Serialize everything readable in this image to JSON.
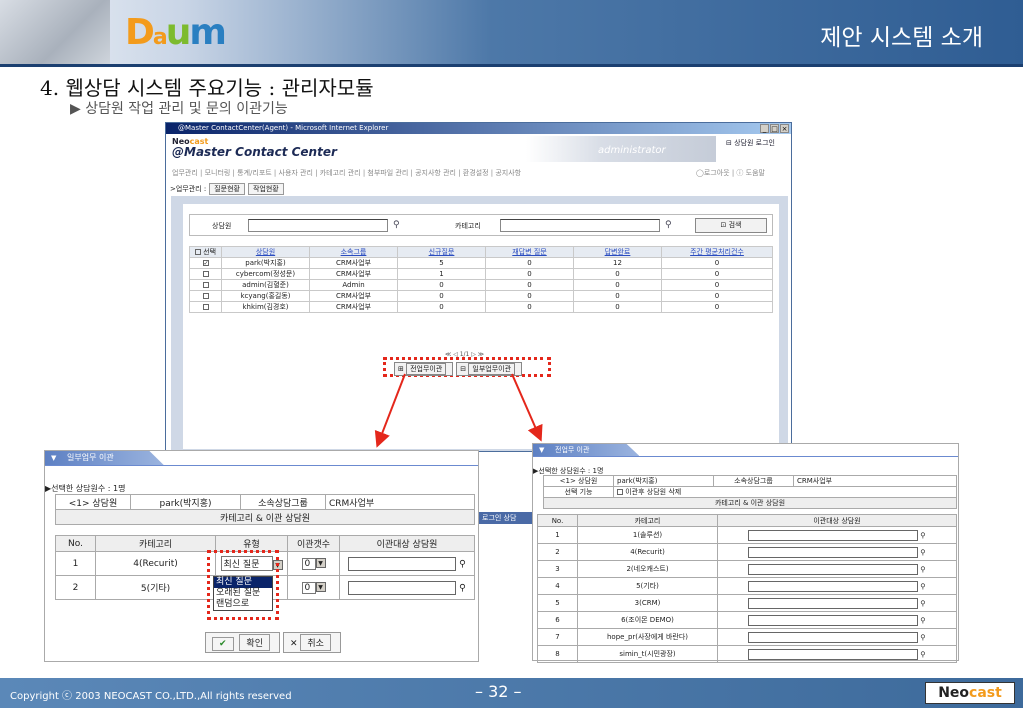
{
  "header": {
    "logo_d": "D",
    "logo_a": "a",
    "logo_u": "u",
    "logo_m": "m",
    "title": "제안 시스템 소개"
  },
  "slide": {
    "heading": "4. 웹상담 시스템 주요기능 : 관리자모듈",
    "subheading": "▶ 상담원 작업 관리 및 문의 이관기능"
  },
  "footer": {
    "copyright": "Copyright ⓒ 2003 NEOCAST CO.,LTD.,All rights reserved",
    "page": "– 32 –",
    "brand_a": "Neo",
    "brand_b": "cast"
  },
  "window": {
    "title": "@Master ContactCenter(Agent) - Microsoft Internet Explorer",
    "brand_top_a": "Neo",
    "brand_top_b": "cast",
    "brand_main": "@Master  Contact  Center",
    "user_label": "administrator",
    "logout_link": "상담원 로그인",
    "menu": "업무관리 | 모니터링 | 통계/리포트 | 사용자 관리 | 카테고리 관리 | 첨부파일 관리 | 공지사항 관리 | 환경설정 | 공지사항",
    "menu_right": "◯로그아웃 | ⓘ 도움말",
    "sub_prefix": ">업무관리 :",
    "sub_tabs": [
      "질문현황",
      "작업현황"
    ],
    "search": {
      "agent_label": "상담원",
      "category_label": "카테고리",
      "button": "검색"
    },
    "table": {
      "headers": [
        "선택",
        "상담원",
        "소속그룹",
        "신규질문",
        "재답변 질문",
        "답변완료",
        "주간 평균처리건수"
      ],
      "rows": [
        {
          "checked": true,
          "name": "park(박지홍)",
          "group": "CRM사업부",
          "new": "5",
          "re": "0",
          "done": "12",
          "avg": "0"
        },
        {
          "checked": false,
          "name": "cybercom(정성문)",
          "group": "CRM사업부",
          "new": "1",
          "re": "0",
          "done": "0",
          "avg": "0"
        },
        {
          "checked": false,
          "name": "admin(김혈준)",
          "group": "Admin",
          "new": "0",
          "re": "0",
          "done": "0",
          "avg": "0"
        },
        {
          "checked": false,
          "name": "kcyang(홍길동)",
          "group": "CRM사업부",
          "new": "0",
          "re": "0",
          "done": "0",
          "avg": "0"
        },
        {
          "checked": false,
          "name": "khkim(김경호)",
          "group": "CRM사업부",
          "new": "0",
          "re": "0",
          "done": "0",
          "avg": "0"
        }
      ]
    },
    "pager": "≪ ◁ 1/1 ▷ ≫",
    "btn_all": "전업무이관",
    "btn_part": "일부업무이관"
  },
  "popup_part": {
    "tab": "일부업무 이관",
    "selected_count": "▶선택한 상담원수 : 1명",
    "agent_label": "<1> 상담원",
    "agent_value": "park(박지홍)",
    "group_label": "소속상담그룹",
    "group_value": "CRM사업부",
    "section": "카테고리 & 이관 상담원",
    "headers": [
      "No.",
      "카테고리",
      "유형",
      "이관갯수",
      "이관대상 상담원"
    ],
    "rows": [
      {
        "no": "1",
        "cat": "4(Recurit)",
        "type": "최신 질문",
        "count": "0"
      },
      {
        "no": "2",
        "cat": "5(기타)",
        "type": "",
        "count": "0"
      }
    ],
    "options": [
      "최신 질문",
      "오래된 질문",
      "랜덤으로"
    ],
    "ok": "확인",
    "cancel": "취소"
  },
  "behind_label": "로그인 상담",
  "popup_all": {
    "tab": "전업무 이관",
    "selected_count": "▶선택한 상담원수 : 1명",
    "agent_label": "<1> 상담원",
    "agent_value": "park(박지홍)",
    "group_label": "소속상담그룹",
    "group_value": "CRM사업부",
    "func_label": "선택 기능",
    "func_value": "이관후 상담원 삭제",
    "section": "카테고리 & 이관 상담원",
    "headers": [
      "No.",
      "카테고리",
      "이관대상 상담원"
    ],
    "rows": [
      {
        "no": "1",
        "cat": "1(솔루션)"
      },
      {
        "no": "2",
        "cat": "4(Recurit)"
      },
      {
        "no": "3",
        "cat": "2(네오캐스트)"
      },
      {
        "no": "4",
        "cat": "5(기타)"
      },
      {
        "no": "5",
        "cat": "3(CRM)"
      },
      {
        "no": "6",
        "cat": "6(조이몬 DEMO)"
      },
      {
        "no": "7",
        "cat": "hope_pr(사장에게 바란다)"
      },
      {
        "no": "8",
        "cat": "simin_t(시민광장)"
      }
    ]
  },
  "colors": {
    "accent_red": "#e4271b",
    "header_blue": "#2f5d93"
  }
}
